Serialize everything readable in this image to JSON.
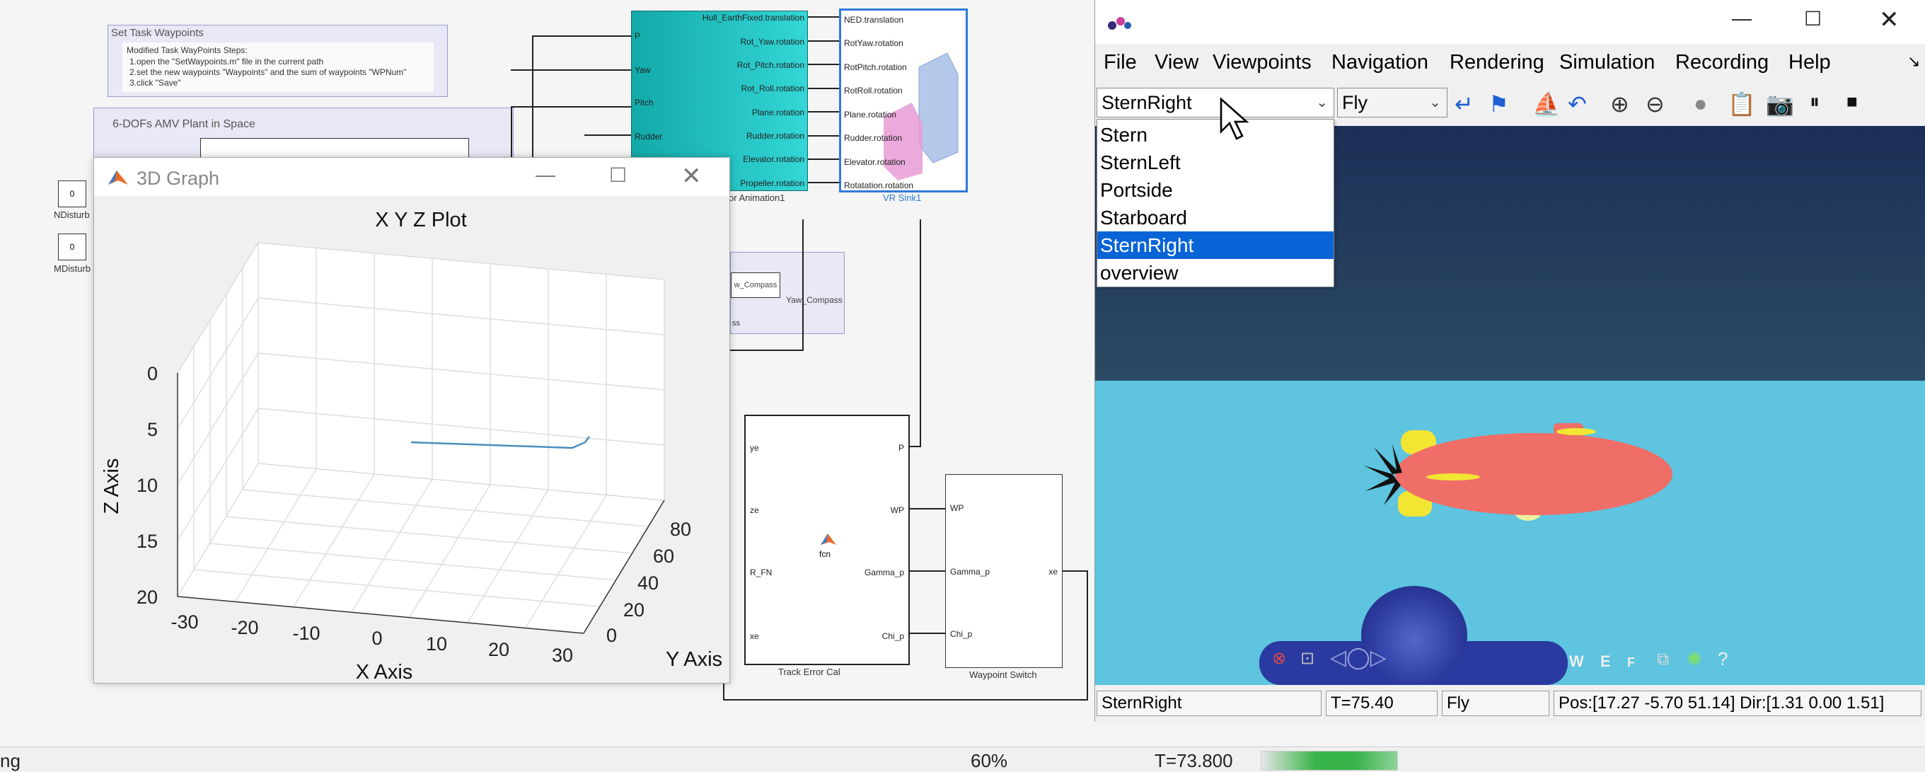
{
  "simulink": {
    "note_waypoints": {
      "title": "Set Task Waypoints",
      "lines": [
        "Modified Task WayPoints Steps:",
        "1.open the \"SetWaypoints.m\" file in the current path",
        "2.set the new waypoints \"Waypoints\" and the sum of waypoints \"WPNum\"",
        "3.click \"Save\""
      ]
    },
    "plant_title": "6-DOFs AMV Plant in Space",
    "const_value_1": "0",
    "const_value_2": "0",
    "label_ndisturb": "NDisturb",
    "label_mdisturb": "MDisturb",
    "animation_block": {
      "inputs": [
        "P",
        "Yaw",
        "Pitch",
        "Rudder"
      ],
      "outputs": [
        "Hull_EarthFixed.translation",
        "Rot_Yaw.rotation",
        "Rot_Pitch.rotation",
        "Rot_Roll.rotation",
        "Plane.rotation",
        "Rudder.rotation",
        "Elevator.rotation",
        "Propeller.rotation"
      ],
      "caption": "or Animation1"
    },
    "vr_sink": {
      "inputs": [
        "NED.translation",
        "RotYaw.rotation",
        "RotPitch.rotation",
        "RotRoll.rotation",
        "Plane.rotation",
        "Rudder.rotation",
        "Elevator.rotation",
        "Rotatation.rotation"
      ],
      "caption": "VR Sink1"
    },
    "compass": {
      "inner": "w_Compass",
      "outer": "Yaw_Compass",
      "sub": "ss"
    },
    "track_error": {
      "inputs": [
        "ye",
        "ze",
        "R_FN",
        "xe"
      ],
      "outputs": [
        "P",
        "WP",
        "Gamma_p",
        "Chi_p"
      ],
      "fcn": "fcn",
      "caption": "Track Error Cal"
    },
    "waypoint_switch": {
      "inputs": [
        "WP",
        "Gamma_p",
        "Chi_p"
      ],
      "output": "xe",
      "caption": "Waypoint Switch"
    }
  },
  "graph_window": {
    "title": "3D Graph",
    "plot_title": "X Y Z Plot",
    "xlabel": "X Axis",
    "ylabel": "Y Axis",
    "zlabel": "Z Axis",
    "xticks": [
      "-30",
      "-20",
      "-10",
      "0",
      "10",
      "20",
      "30"
    ],
    "yticks": [
      "0",
      "20",
      "40",
      "60",
      "80"
    ],
    "zticks": [
      "0",
      "5",
      "10",
      "15",
      "20"
    ]
  },
  "vr_window": {
    "menu": [
      "File",
      "View",
      "Viewpoints",
      "Navigation",
      "Rendering",
      "Simulation",
      "Recording",
      "Help"
    ],
    "viewpoint_selected": "SternRight",
    "nav_mode": "Fly",
    "viewpoint_options": [
      "Stern",
      "SternLeft",
      "Portside",
      "Starboard",
      "SternRight",
      "overview"
    ],
    "highlighted_option": "SternRight",
    "nav_panel_letters": [
      "W",
      "E",
      "F"
    ],
    "status": {
      "viewpoint": "SternRight",
      "time": "T=75.40",
      "mode": "Fly",
      "pos": "Pos:[17.27 -5.70 51.14] Dir:[1.31 0.00 1.51]"
    }
  },
  "status_bar": {
    "left_text": "ng",
    "zoom": "60%",
    "time": "T=73.800"
  },
  "colors": {
    "animation_block": "#20c0c0",
    "vr_sky_top": "#1c2f57",
    "vr_sky_bottom": "#2c4a63",
    "vr_water": "#5ec4df",
    "submarine_hull": "#f06e68",
    "fins": "#f2e633",
    "selection": "#0a64d8"
  }
}
